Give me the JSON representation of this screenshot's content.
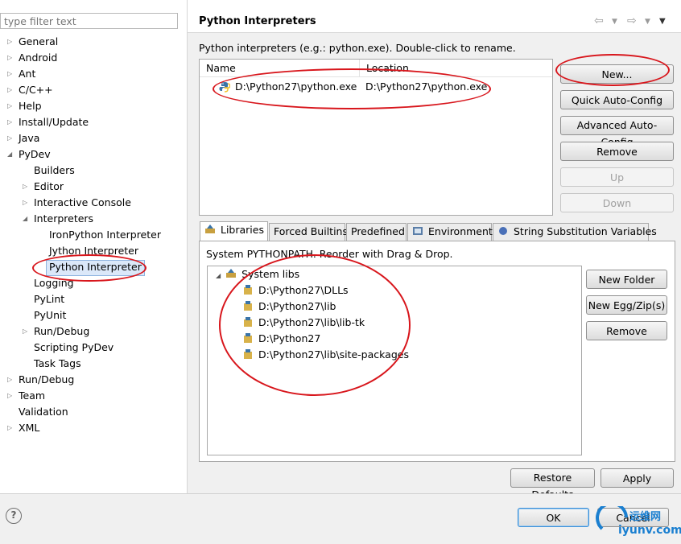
{
  "filter": {
    "placeholder": "type filter text"
  },
  "tree": {
    "general": "General",
    "android": "Android",
    "ant": "Ant",
    "cpp": "C/C++",
    "help": "Help",
    "install_update": "Install/Update",
    "java": "Java",
    "pydev": "PyDev",
    "builders": "Builders",
    "editor": "Editor",
    "interactive_console": "Interactive Console",
    "interpreters": "Interpreters",
    "ironpython": "IronPython Interpreter",
    "jython": "Jython Interpreter",
    "python": "Python Interpreter",
    "logging": "Logging",
    "pylint": "PyLint",
    "pyunit": "PyUnit",
    "run_debug_pydev": "Run/Debug",
    "scripting_pydev": "Scripting PyDev",
    "task_tags": "Task Tags",
    "run_debug": "Run/Debug",
    "team": "Team",
    "validation": "Validation",
    "xml": "XML"
  },
  "page": {
    "title": "Python Interpreters",
    "description": "Python interpreters (e.g.: python.exe).   Double-click to rename."
  },
  "interpreters_table": {
    "columns": {
      "name": "Name",
      "location": "Location"
    },
    "rows": [
      {
        "name": "D:\\Python27\\python.exe",
        "location": "D:\\Python27\\python.exe"
      }
    ]
  },
  "interp_buttons": {
    "new": "New...",
    "quick": "Quick Auto-Config",
    "advanced": "Advanced Auto-Config",
    "remove": "Remove",
    "up": "Up",
    "down": "Down"
  },
  "tabs": {
    "libraries": "Libraries",
    "forced_builtins": "Forced Builtins",
    "predefined": "Predefined",
    "environment": "Environment",
    "string_subst": "String Substitution Variables"
  },
  "libraries": {
    "hint": "System PYTHONPATH.   Reorder with Drag & Drop.",
    "root": "System libs",
    "items": [
      "D:\\Python27\\DLLs",
      "D:\\Python27\\lib",
      "D:\\Python27\\lib\\lib-tk",
      "D:\\Python27",
      "D:\\Python27\\lib\\site-packages"
    ]
  },
  "lib_buttons": {
    "new_folder": "New Folder",
    "new_egg": "New Egg/Zip(s)",
    "remove": "Remove"
  },
  "footer": {
    "restore_defaults": "Restore Defaults",
    "apply": "Apply",
    "ok": "OK",
    "cancel": "Cancel"
  },
  "watermark": {
    "text1": "运维网",
    "text2": "iyunv.com"
  },
  "colors": {
    "annotation": "#d8161c",
    "selection": "#dbe8f9"
  }
}
